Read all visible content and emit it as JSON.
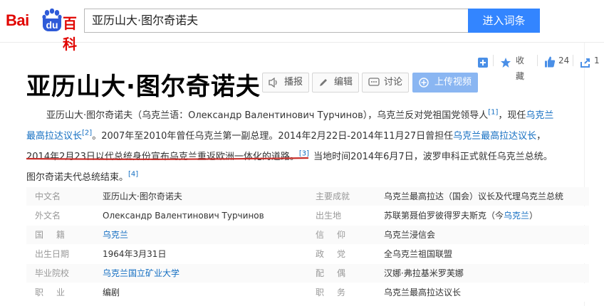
{
  "header": {
    "logo": {
      "bai": "Bai",
      "du": "du",
      "baike": "百科"
    },
    "search_value": "亚历山大·图尔奇诺夫",
    "search_button": "进入词条"
  },
  "actions": {
    "collect": "收藏",
    "likes": "24",
    "shares": "1"
  },
  "title": "亚历山大·图尔奇诺夫",
  "title_buttons": {
    "play": "播报",
    "edit": "编辑",
    "discuss": "讨论",
    "upload": "上传视频"
  },
  "summary": {
    "line1": {
      "a": "亚历山大·图尔奇诺夫（乌克兰语：Олександр Валентинович Турчинов），乌克兰反对党祖国党领导人",
      "ref1": "[1]",
      "b": "，现任",
      "link1": "乌克兰"
    },
    "line2": {
      "link1": "最高拉达议长",
      "ref2": "[2]",
      "b": "。2007年至2010年曾任乌克兰第一副总理。2014年2月22日-2014年11月27日曾担任",
      "link2": "乌克兰最高拉达议长",
      "c": "，"
    },
    "line3": {
      "a": "2014年2月23日以代总统身份宣布乌克兰重返欧洲一体化的道路。",
      "ref3": "[3]",
      "b": "当地时间2014年6月7日，波罗申科正式就任乌克兰总统。"
    },
    "line4": {
      "a": "图尔奇诺夫代总统结束。",
      "ref4": "[4]"
    }
  },
  "infobox": {
    "left": [
      {
        "label": "中文名",
        "value": "亚历山大·图尔奇诺夫"
      },
      {
        "label": "外文名",
        "value": "Олександр Валентинович Турчинов"
      },
      {
        "label": "国籍",
        "value": "乌克兰"
      },
      {
        "label": "出生日期",
        "value": "1964年3月31日"
      },
      {
        "label": "毕业院校",
        "value": "乌克兰国立矿业大学"
      },
      {
        "label": "职业",
        "value": "编剧"
      }
    ],
    "right": [
      {
        "label": "主要成就",
        "value": "乌克兰最高拉达（国会）议长及代理乌克兰总统"
      },
      {
        "label": "出生地",
        "value_a": "苏联第聂伯罗彼得罗夫斯克（今",
        "value_link": "乌克兰",
        "value_b": "）"
      },
      {
        "label": "信仰",
        "value": "乌克兰浸信会"
      },
      {
        "label": "政党",
        "value": "全乌克兰祖国联盟"
      },
      {
        "label": "配偶",
        "value": "汉娜·弗拉基米罗芙娜"
      },
      {
        "label": "职务",
        "value": "乌克兰最高拉达议长"
      }
    ]
  }
}
